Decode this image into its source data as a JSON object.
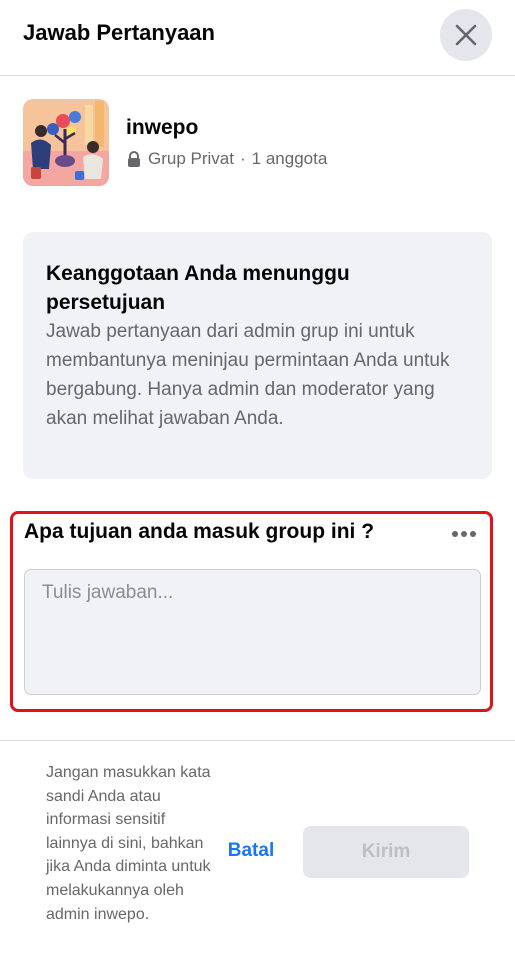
{
  "header": {
    "title": "Jawab Pertanyaan",
    "close_icon": "close-icon"
  },
  "group": {
    "name": "inwepo",
    "privacy": "Grup Privat",
    "separator": "·",
    "members": "1 anggota",
    "lock_icon": "lock-icon"
  },
  "notice": {
    "title": "Keanggotaan Anda menunggu persetujuan",
    "body": "Jawab pertanyaan dari admin grup ini untuk membantunya meninjau permintaan Anda untuk bergabung. Hanya admin dan moderator yang akan melihat jawaban Anda."
  },
  "question": {
    "text": "Apa tujuan anda masuk group ini ?",
    "answer_value": "",
    "answer_placeholder": "Tulis jawaban...",
    "more_icon": "more-dots-icon",
    "highlight_color": "#e0121a"
  },
  "footer": {
    "note": "Jangan masukkan kata sandi Anda atau informasi sensitif lainnya di sini, bahkan jika Anda diminta untuk melakukannya oleh admin inwepo.",
    "cancel_label": "Batal",
    "send_label": "Kirim",
    "accent_color": "#1877f2"
  }
}
